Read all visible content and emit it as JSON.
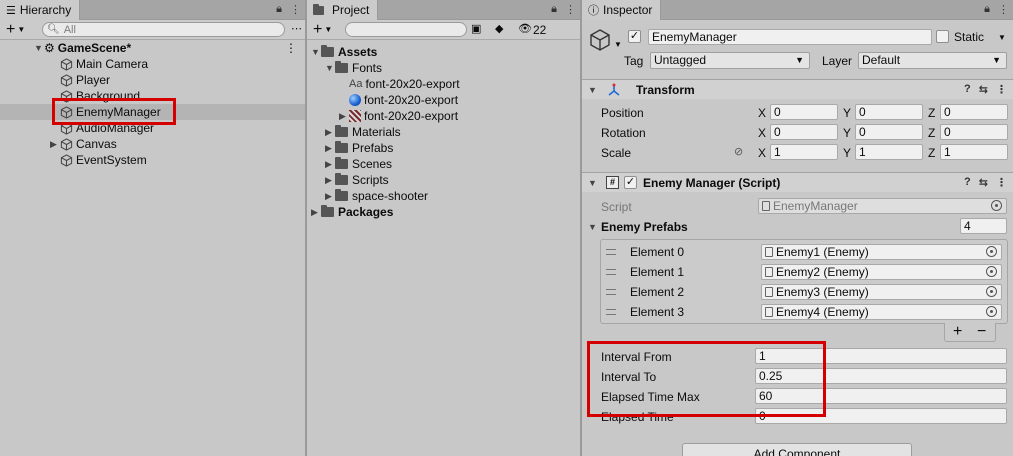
{
  "hierarchy": {
    "tab": "Hierarchy",
    "search_placeholder": "All",
    "scene": "GameScene*",
    "items": [
      {
        "label": "Main Camera"
      },
      {
        "label": "Player"
      },
      {
        "label": "Background"
      },
      {
        "label": "EnemyManager",
        "selected": true
      },
      {
        "label": "AudioManager"
      },
      {
        "label": "Canvas",
        "expandable": true
      },
      {
        "label": "EventSystem"
      }
    ]
  },
  "project": {
    "tab": "Project",
    "hidden_count": "22",
    "tree": {
      "assets": "Assets",
      "fonts": "Fonts",
      "font_files": [
        "font-20x20-export",
        "font-20x20-export",
        "font-20x20-export"
      ],
      "font_prefix": "Aa",
      "folders": [
        "Materials",
        "Prefabs",
        "Scenes",
        "Scripts",
        "space-shooter"
      ],
      "packages": "Packages"
    }
  },
  "inspector": {
    "tab": "Inspector",
    "object_name": "EnemyManager",
    "static_label": "Static",
    "tag_label": "Tag",
    "tag_value": "Untagged",
    "layer_label": "Layer",
    "layer_value": "Default",
    "transform": {
      "title": "Transform",
      "rows": [
        {
          "label": "Position",
          "x": "0",
          "y": "0",
          "z": "0"
        },
        {
          "label": "Rotation",
          "x": "0",
          "y": "0",
          "z": "0"
        },
        {
          "label": "Scale",
          "x": "1",
          "y": "1",
          "z": "1"
        }
      ],
      "axis": {
        "x": "X",
        "y": "Y",
        "z": "Z"
      }
    },
    "script_component": {
      "title": "Enemy Manager (Script)",
      "script_label": "Script",
      "script_value": "EnemyManager",
      "prefabs_label": "Enemy Prefabs",
      "prefabs_count": "4",
      "elements": [
        {
          "label": "Element 0",
          "value": "Enemy1 (Enemy)"
        },
        {
          "label": "Element 1",
          "value": "Enemy2 (Enemy)"
        },
        {
          "label": "Element 2",
          "value": "Enemy3 (Enemy)"
        },
        {
          "label": "Element 3",
          "value": "Enemy4 (Enemy)"
        }
      ],
      "plus": "+",
      "minus": "−",
      "fields": [
        {
          "label": "Interval From",
          "value": "1"
        },
        {
          "label": "Interval To",
          "value": "0.25"
        },
        {
          "label": "Elapsed Time Max",
          "value": "60"
        },
        {
          "label": "Elapsed Time",
          "value": "0"
        }
      ]
    },
    "add_component": "Add Component"
  },
  "colors": {
    "highlight": "#d40000",
    "selection": "#b6b6b6",
    "panel": "#c8c8c8"
  }
}
